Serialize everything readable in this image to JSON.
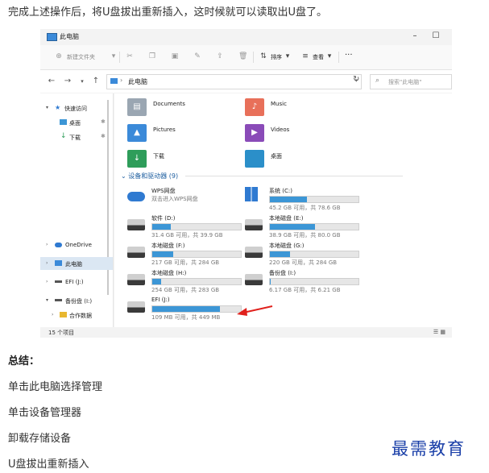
{
  "intro_text": "完成上述操作后，将U盘拔出重新插入，这时候就可以读取出U盘了。",
  "window": {
    "title": "此电脑",
    "controls": {
      "minimize": "–",
      "maximize": "☐",
      "close": "✕"
    }
  },
  "toolbar": {
    "new_folder": "新建文件夹",
    "sort": "排序",
    "view": "查看",
    "more": "···"
  },
  "address": {
    "path": "此电脑",
    "search_placeholder": "搜索\"此电脑\""
  },
  "sidebar": {
    "quick_access": "快速访问",
    "desktop": "桌面",
    "downloads": "下载",
    "onedrive": "OneDrive",
    "this_pc": "此电脑",
    "efi": "EFI (J:)",
    "backup": "备份盘 (I:)",
    "cooperation": "合作数据"
  },
  "folders": [
    {
      "name": "Documents",
      "icon": "documents-folder-icon"
    },
    {
      "name": "Music",
      "icon": "music-folder-icon"
    },
    {
      "name": "Pictures",
      "icon": "pictures-folder-icon"
    },
    {
      "name": "Videos",
      "icon": "videos-folder-icon"
    },
    {
      "name": "下载",
      "icon": "downloads-folder-icon"
    },
    {
      "name": "桌面",
      "icon": "desktop-folder-icon"
    }
  ],
  "devices_header": "设备和驱动器 (9)",
  "drives": [
    {
      "name": "WPS网盘",
      "sub": "双击进入WPS网盘",
      "type": "cloud"
    },
    {
      "name": "系统 (C:)",
      "free": "45.2 GB 可用，共 78.6 GB",
      "used_fraction": 0.42,
      "type": "windows"
    },
    {
      "name": "软件 (D:)",
      "free": "31.4 GB 可用，共 39.9 GB",
      "used_fraction": 0.21,
      "type": "disk"
    },
    {
      "name": "本地磁盘 (E:)",
      "free": "38.9 GB 可用，共 80.0 GB",
      "used_fraction": 0.51,
      "type": "disk"
    },
    {
      "name": "本地磁盘 (F:)",
      "free": "217 GB 可用，共 284 GB",
      "used_fraction": 0.24,
      "type": "disk"
    },
    {
      "name": "本地磁盘 (G:)",
      "free": "220 GB 可用，共 284 GB",
      "used_fraction": 0.23,
      "type": "disk"
    },
    {
      "name": "本地磁盘 (H:)",
      "free": "254 GB 可用，共 283 GB",
      "used_fraction": 0.1,
      "type": "disk"
    },
    {
      "name": "备份盘 (I:)",
      "free": "6.17 GB 可用，共 6.21 GB",
      "used_fraction": 0.01,
      "type": "disk"
    },
    {
      "name": "EFI (J:)",
      "free": "109 MB 可用，共 449 MB",
      "used_fraction": 0.76,
      "type": "disk"
    }
  ],
  "status": {
    "count": "15 个项目"
  },
  "colors": {
    "accent": "#3c96d6",
    "arrow": "#e0201c",
    "watermark": "#1a3fa8"
  },
  "summary": {
    "title": "总结：",
    "steps": [
      "单击此电脑选择管理",
      "单击设备管理器",
      "卸载存储设备",
      "U盘拔出重新插入"
    ]
  },
  "watermark": "最需教育"
}
